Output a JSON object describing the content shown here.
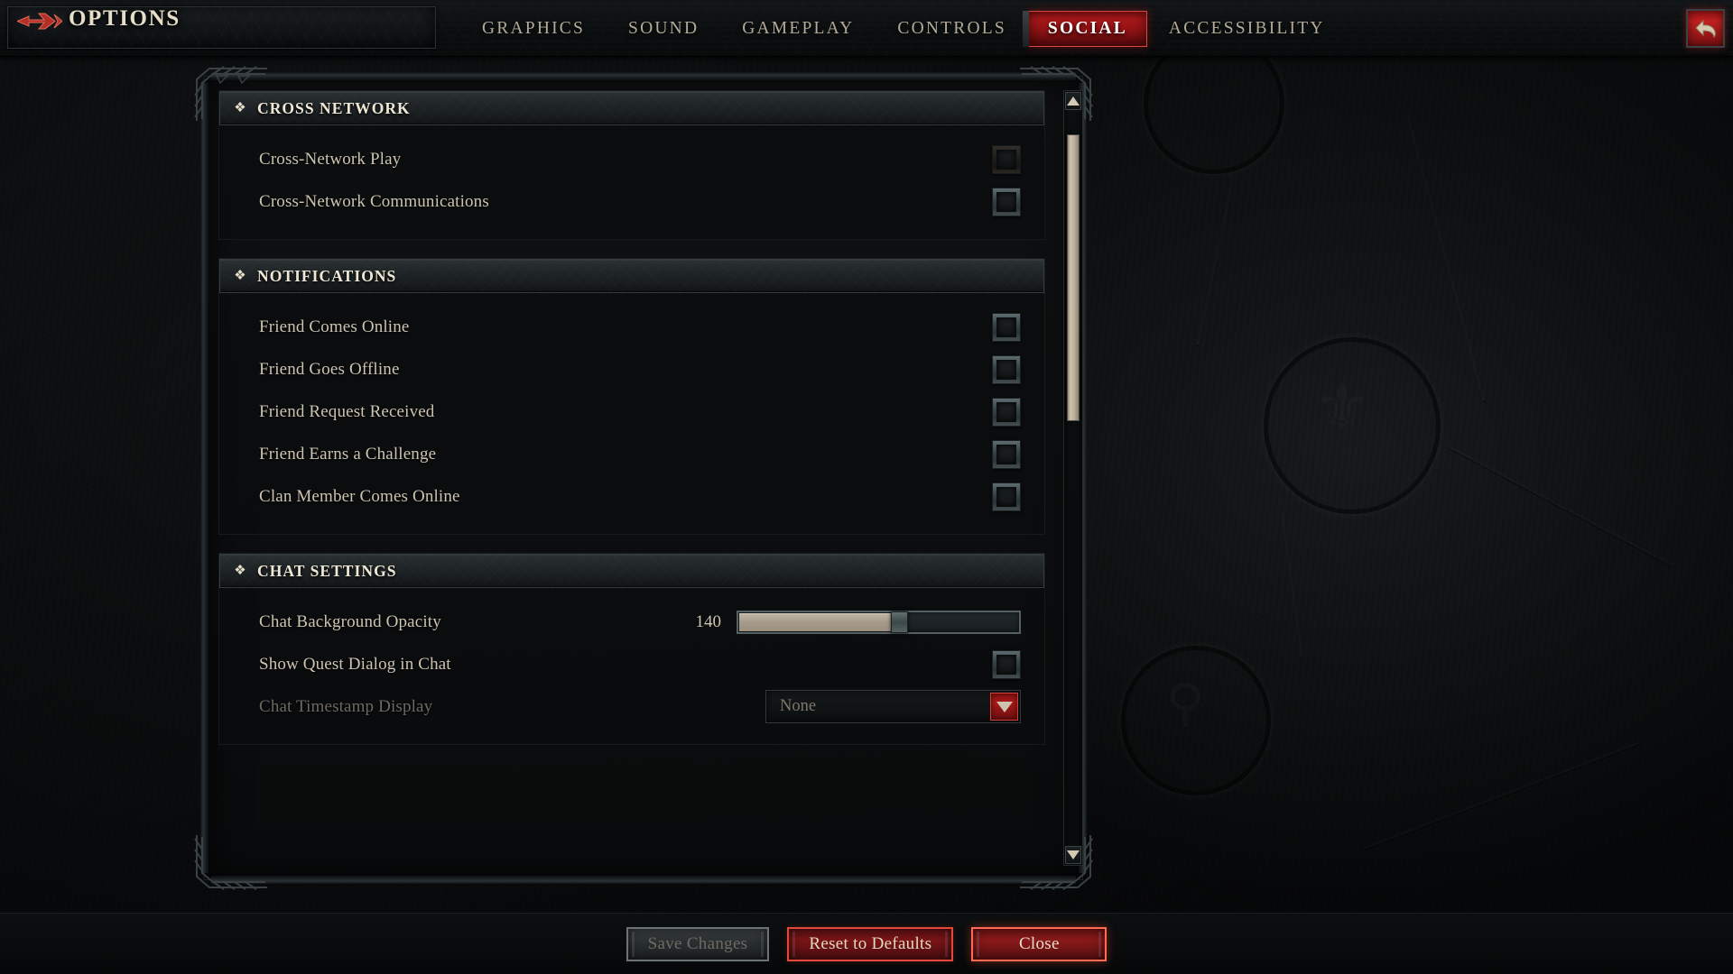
{
  "header": {
    "title": "OPTIONS",
    "back_arrow_icon": "arrow-right-icon",
    "back_button_icon": "undo-arrow-icon",
    "tabs": [
      {
        "label": "GRAPHICS",
        "active": false
      },
      {
        "label": "SOUND",
        "active": false
      },
      {
        "label": "GAMEPLAY",
        "active": false
      },
      {
        "label": "CONTROLS",
        "active": false
      },
      {
        "label": "SOCIAL",
        "active": true
      },
      {
        "label": "ACCESSIBILITY",
        "active": false
      }
    ]
  },
  "colors": {
    "accent_red": "#b2191a",
    "tab_active_border": "#d8483f",
    "text_primary": "#cdc4b1",
    "text_heading": "#efe8d6",
    "text_disabled": "#6f6a61",
    "slider_fill": "#a89d8c",
    "scrollbar_thumb": "#cdc3ae"
  },
  "sections": [
    {
      "title": "CROSS NETWORK",
      "icon": "diamond-sparkle-icon",
      "rows": [
        {
          "label": "Cross-Network Play",
          "type": "checkbox",
          "checked": false,
          "enabled": true,
          "style": "dim"
        },
        {
          "label": "Cross-Network Communications",
          "type": "checkbox",
          "checked": false,
          "enabled": true,
          "style": "normal"
        }
      ]
    },
    {
      "title": "NOTIFICATIONS",
      "icon": "diamond-sparkle-icon",
      "rows": [
        {
          "label": "Friend Comes Online",
          "type": "checkbox",
          "checked": false,
          "enabled": true,
          "style": "normal"
        },
        {
          "label": "Friend Goes Offline",
          "type": "checkbox",
          "checked": false,
          "enabled": true,
          "style": "normal"
        },
        {
          "label": "Friend Request Received",
          "type": "checkbox",
          "checked": false,
          "enabled": true,
          "style": "normal"
        },
        {
          "label": "Friend Earns a Challenge",
          "type": "checkbox",
          "checked": false,
          "enabled": true,
          "style": "normal"
        },
        {
          "label": "Clan Member Comes Online",
          "type": "checkbox",
          "checked": false,
          "enabled": true,
          "style": "normal"
        }
      ]
    },
    {
      "title": "CHAT SETTINGS",
      "icon": "diamond-sparkle-icon",
      "rows": [
        {
          "label": "Chat Background Opacity",
          "type": "slider",
          "value": "140",
          "percent": 55,
          "enabled": true
        },
        {
          "label": "Show Quest Dialog in Chat",
          "type": "checkbox",
          "checked": false,
          "enabled": true,
          "style": "normal"
        },
        {
          "label": "Chat Timestamp Display",
          "type": "dropdown",
          "value": "None",
          "enabled": false,
          "dropdown_icon": "chevron-down-icon"
        }
      ]
    }
  ],
  "scrollbar": {
    "up_icon": "triangle-up-icon",
    "down_icon": "triangle-down-icon",
    "thumb_top_percent": 3,
    "thumb_height_percent": 37
  },
  "footer": {
    "buttons": [
      {
        "label": "Save Changes",
        "style": "disabled",
        "enabled": false
      },
      {
        "label": "Reset to Defaults",
        "style": "red-dark",
        "enabled": true
      },
      {
        "label": "Close",
        "style": "red-bright",
        "enabled": true
      }
    ]
  }
}
